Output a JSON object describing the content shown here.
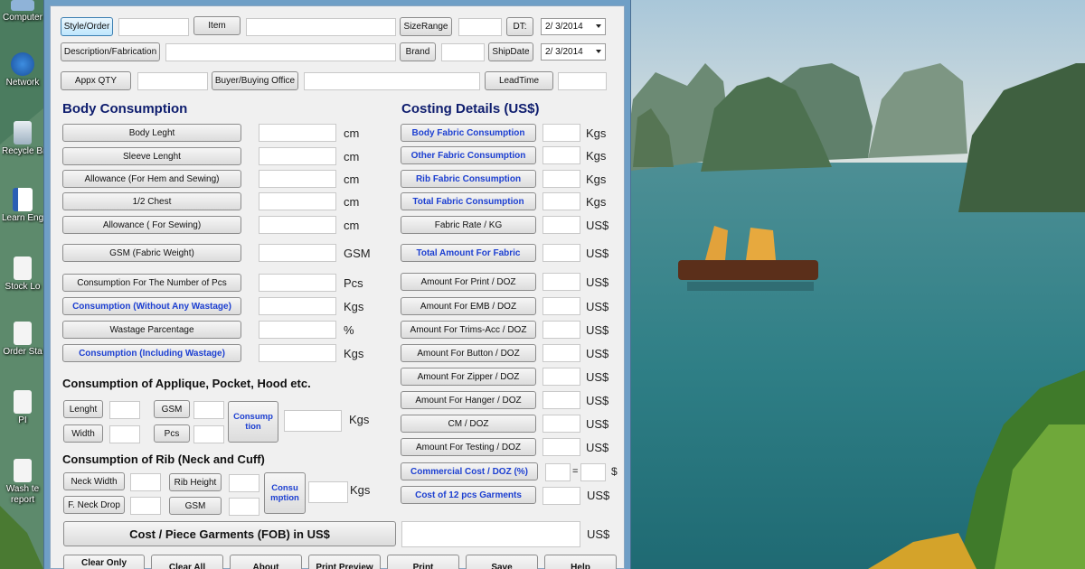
{
  "header": {
    "style_order": "Style/Order",
    "item": "Item",
    "size_range": "SizeRange",
    "dt": "DT:",
    "dt_value": "2/  3/2014",
    "description": "Description/Fabrication",
    "brand": "Brand",
    "ship_date": "ShipDate",
    "ship_date_value": "2/  3/2014",
    "appx_qty": "Appx QTY",
    "buyer": "Buyer/Buying Office",
    "lead_time": "LeadTime"
  },
  "body": {
    "title": "Body Consumption",
    "rows": [
      {
        "label": "Body Leght",
        "unit": "cm"
      },
      {
        "label": "Sleeve Lenght",
        "unit": "cm"
      },
      {
        "label": "Allowance (For Hem and Sewing)",
        "unit": "cm"
      },
      {
        "label": "1/2 Chest",
        "unit": "cm"
      },
      {
        "label": "Allowance ( For Sewing)",
        "unit": "cm"
      },
      {
        "label": "GSM (Fabric Weight)",
        "unit": "GSM"
      },
      {
        "label": "Consumption For The Number of Pcs",
        "unit": "Pcs"
      },
      {
        "label": "Consumption (Without Any Wastage)",
        "unit": "Kgs"
      },
      {
        "label": "Wastage Parcentage",
        "unit": "%"
      },
      {
        "label": "Consumption (Including Wastage)",
        "unit": "Kgs"
      }
    ]
  },
  "applique": {
    "title": "Consumption of Applique, Pocket, Hood etc.",
    "lenght": "Lenght",
    "gsm": "GSM",
    "width": "Width",
    "pcs": "Pcs",
    "consumption": "Consump tion",
    "unit": "Kgs"
  },
  "rib": {
    "title": "Consumption of Rib (Neck and Cuff)",
    "neck_width": "Neck Width",
    "rib_height": "Rib Height",
    "neck_drop": "F. Neck Drop",
    "gsm": "GSM",
    "consumption": "Consu mption",
    "unit": "Kgs"
  },
  "costing": {
    "title": "Costing Details (US$)",
    "rows": [
      {
        "label": "Body Fabric Consumption",
        "unit": "Kgs"
      },
      {
        "label": "Other Fabric Consumption",
        "unit": "Kgs"
      },
      {
        "label": "Rib Fabric Consumption",
        "unit": "Kgs"
      },
      {
        "label": "Total Fabric Consumption",
        "unit": "Kgs"
      },
      {
        "label": "Fabric Rate / KG",
        "unit": "US$"
      },
      {
        "label": "Total Amount For Fabric",
        "unit": "US$"
      },
      {
        "label": "Amount For Print / DOZ",
        "unit": "US$"
      },
      {
        "label": "Amount For EMB / DOZ",
        "unit": "US$"
      },
      {
        "label": "Amount For Trims-Acc / DOZ",
        "unit": "US$"
      },
      {
        "label": "Amount For Button / DOZ",
        "unit": "US$"
      },
      {
        "label": "Amount For Zipper / DOZ",
        "unit": "US$"
      },
      {
        "label": "Amount For Hanger / DOZ",
        "unit": "US$"
      },
      {
        "label": "CM / DOZ",
        "unit": "US$"
      },
      {
        "label": "Amount For Testing / DOZ",
        "unit": "US$"
      }
    ],
    "commercial": "Commercial Cost / DOZ (%)",
    "equals": "=",
    "dollar": "$",
    "cost_12": "Cost of 12 pcs Garments",
    "cost_12_unit": "US$"
  },
  "fob": {
    "label": "Cost / Piece Garments (FOB) in US$",
    "unit": "US$"
  },
  "footer": {
    "clear_only": "Clear Only",
    "clear_all": "Clear All",
    "about": "About",
    "print_preview": "Print Preview",
    "print": "Print",
    "save": "Save",
    "help": "Help"
  },
  "desktop": {
    "icons": [
      {
        "label": "Computer",
        "icon": "computer-icon"
      },
      {
        "label": "Network",
        "icon": "network-icon"
      },
      {
        "label": "Recycle Bin",
        "icon": "recycle-bin-icon"
      },
      {
        "label": "Learn Eng - Shortc",
        "icon": "word-document-icon"
      },
      {
        "label": "Stock Lo",
        "icon": "document-icon"
      },
      {
        "label": "Order Sta",
        "icon": "document-icon"
      },
      {
        "label": "PI",
        "icon": "document-icon"
      },
      {
        "label": "Wash te report",
        "icon": "document-icon"
      }
    ]
  }
}
